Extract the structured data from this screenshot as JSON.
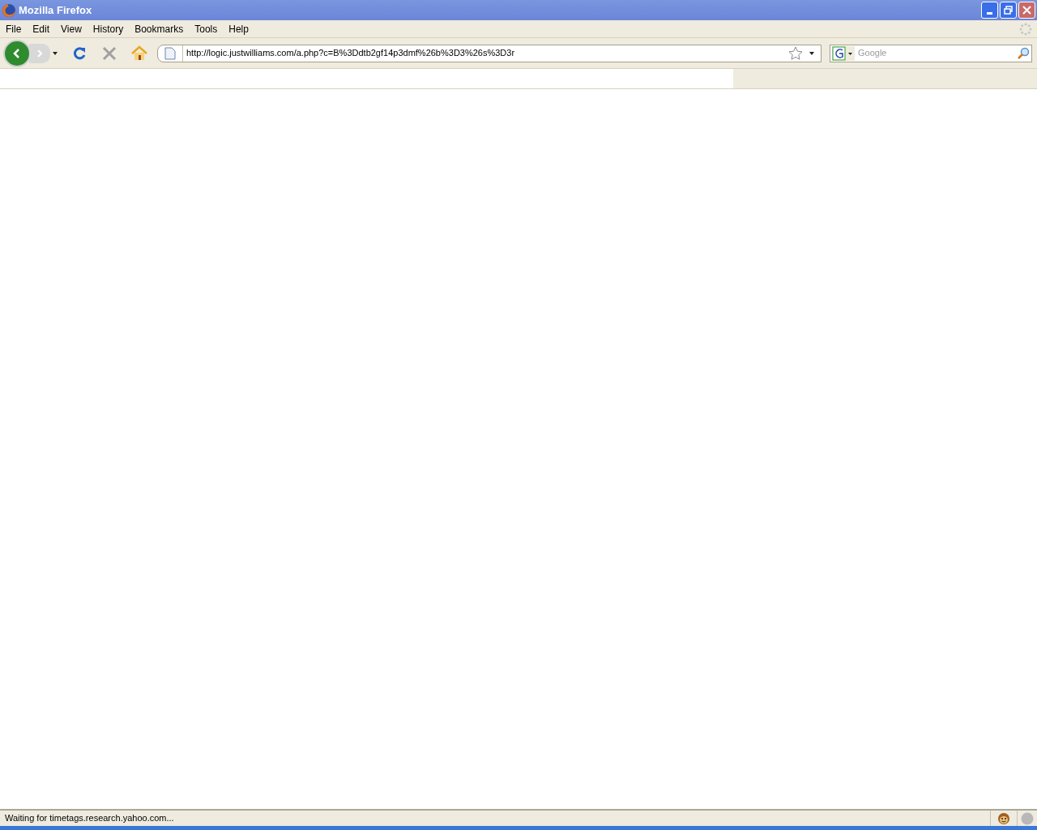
{
  "window": {
    "title": "Mozilla Firefox"
  },
  "menu": [
    "File",
    "Edit",
    "View",
    "History",
    "Bookmarks",
    "Tools",
    "Help"
  ],
  "address": {
    "value": "http://logic.justwilliams.com/a.php?c=B%3Ddtb2gf14p3dmf%26b%3D3%26s%3D3r"
  },
  "search": {
    "placeholder": "Google"
  },
  "status_bar": {
    "text": "Waiting for timetags.research.yahoo.com..."
  }
}
